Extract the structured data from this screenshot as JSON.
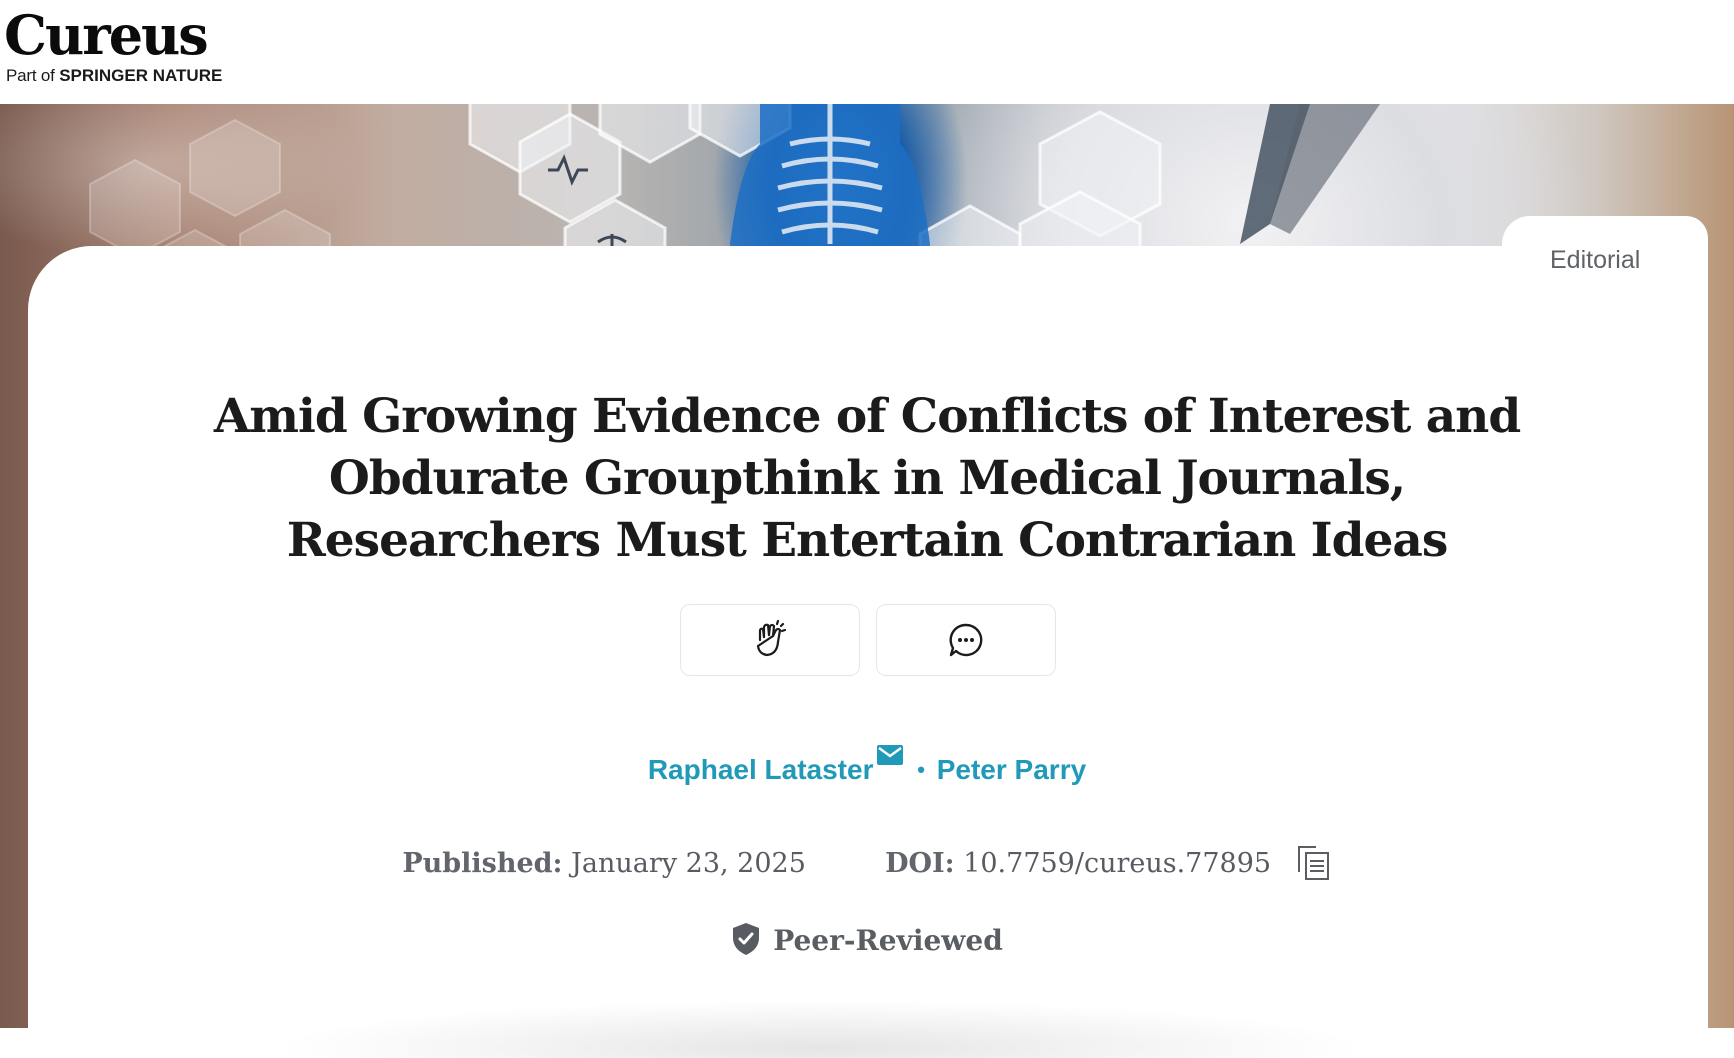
{
  "brand": {
    "name": "Cureus",
    "tagline_prefix": "Part of",
    "tagline_company": "SPRINGER NATURE"
  },
  "hero": {
    "image_description_icons": [
      "hexagon-medical-icons",
      "skeleton-scan"
    ]
  },
  "article": {
    "type_label": "Editorial",
    "title": "Amid Growing Evidence of Conflicts of Interest and Obdurate Groupthink in Medical Journals, Researchers Must Entertain Contrarian Ideas",
    "authors": [
      {
        "name": "Raphael Lataster",
        "corresponding": true
      },
      {
        "name": "Peter Parry",
        "corresponding": false
      }
    ],
    "author_separator": "•",
    "published_label": "Published:",
    "published_date": "January 23, 2025",
    "doi_label": "DOI:",
    "doi_value": "10.7759/cureus.77895",
    "peer_review_label": "Peer-Reviewed"
  },
  "actions": {
    "clap_icon": "clap-icon",
    "comment_icon": "comment-bubble-icon"
  },
  "colors": {
    "link": "#2199b8",
    "title": "#1b1b1b",
    "meta": "#585c62"
  }
}
